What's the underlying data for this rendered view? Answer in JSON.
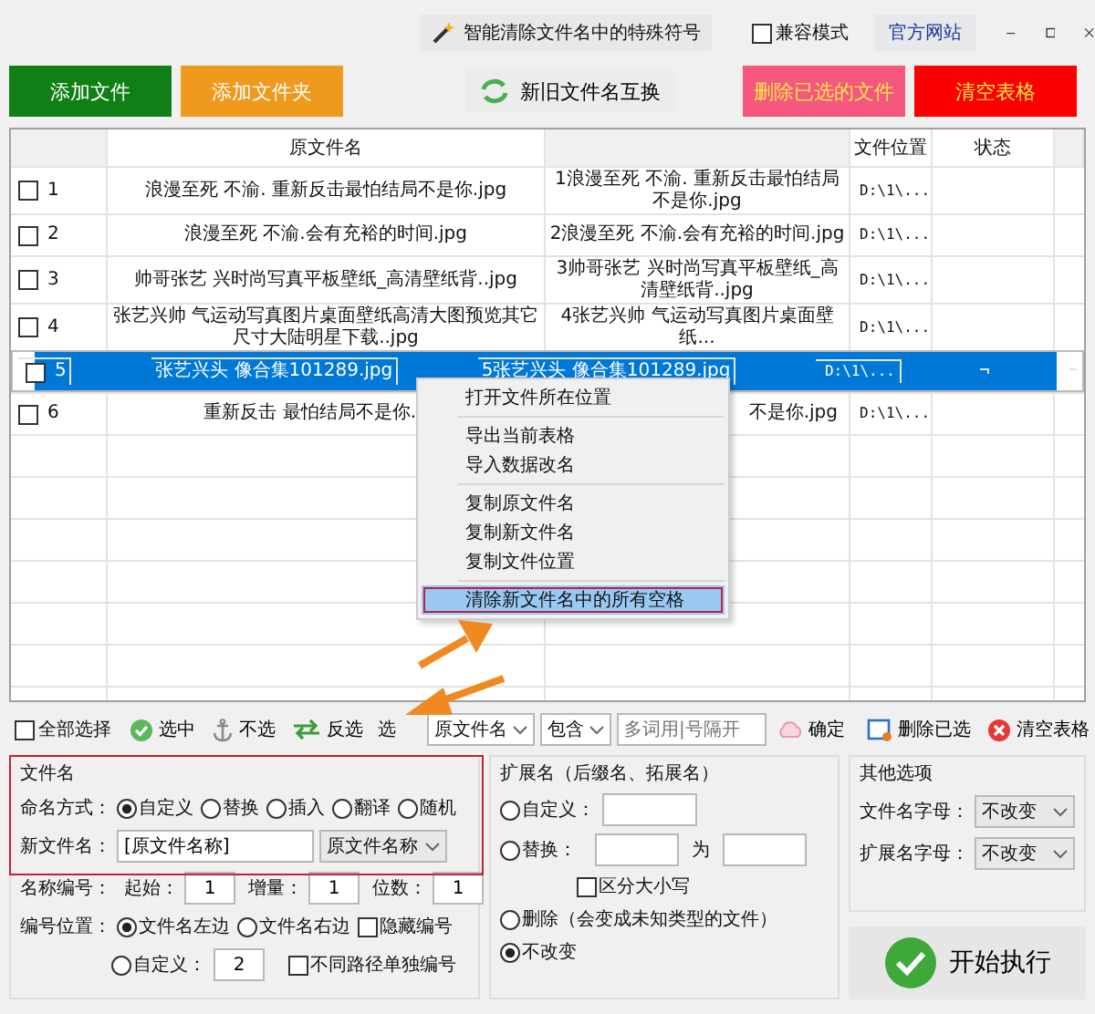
{
  "title_bar": {
    "title": "智能清除文件名中的特殊符号",
    "compat_mode": {
      "label": "兼容模式",
      "checked": false
    },
    "website_link": "官方网站"
  },
  "toolbar": [
    {
      "label": "添加文件",
      "kind": "solid",
      "color": "#108016"
    },
    {
      "label": "添加文件夹",
      "kind": "solid",
      "color": "#ef9a1c"
    },
    {
      "label": "新旧文件名互换",
      "kind": "swap"
    },
    {
      "label": "删除已选的文件",
      "kind": "solid",
      "color": "#f5577f"
    },
    {
      "label": "清空表格",
      "kind": "solid",
      "color": "#fc0000"
    }
  ],
  "table": {
    "header": {
      "column_2": "原文件名",
      "column_4": "文件位置",
      "column_5": "状态"
    },
    "rows": [
      {
        "checked": false,
        "number": "1",
        "original": "浪漫至死 不渝. 重新反击最怕结局不是你.jpg",
        "new": "1浪漫至死 不渝. 重新反击最怕结局不是你.jpg",
        "location": "D:\\1\\...",
        "selected": false
      },
      {
        "checked": false,
        "number": "2",
        "original": "浪漫至死 不渝.会有充裕的时间.jpg",
        "new": "2浪漫至死 不渝.会有充裕的时间.jpg",
        "location": "D:\\1\\...",
        "selected": false
      },
      {
        "checked": false,
        "number": "3",
        "original": "帅哥张艺 兴时尚写真平板壁纸_高清壁纸背..jpg",
        "new": "3帅哥张艺 兴时尚写真平板壁纸_高清壁纸背..jpg",
        "location": "D:\\1\\...",
        "selected": false
      },
      {
        "checked": false,
        "number": "4",
        "original": "张艺兴帅 气运动写真图片桌面壁纸高清大图预览其它尺寸大陆明星下载..jpg",
        "new": "4张艺兴帅 气运动写真图片桌面壁纸...",
        "location": "D:\\1\\...",
        "selected": false
      },
      {
        "checked": false,
        "number": "5",
        "original": "张艺兴头 像合集101289.jpg",
        "new": "5张艺兴头 像合集101289.jpg",
        "location": "D:\\1\\...",
        "selected": true
      },
      {
        "checked": false,
        "number": "6",
        "original": "重新反击 最怕结局不是你.",
        "new": "不是你.jpg",
        "location": "D:\\1\\...",
        "selected": false
      }
    ]
  },
  "context_menu": {
    "groups": [
      [
        {
          "label": "打开文件所在位置",
          "selected": false
        }
      ],
      [
        {
          "label": "导出当前表格",
          "selected": false
        },
        {
          "label": "导入数据改名",
          "selected": false
        }
      ],
      [
        {
          "label": "复制原文件名",
          "selected": false
        },
        {
          "label": "复制新文件名",
          "selected": false
        },
        {
          "label": "复制文件位置",
          "selected": false
        }
      ],
      [
        {
          "label": "清除新文件名中的所有空格",
          "selected": true
        }
      ]
    ]
  },
  "filter_bar": {
    "select_all": {
      "label": "全部选择",
      "checked": false
    },
    "actions": [
      {
        "label": "选中",
        "kind": "check"
      },
      {
        "label": "不选",
        "kind": "anchor"
      },
      {
        "label": "反选",
        "kind": "swap"
      }
    ],
    "cut_label": "选",
    "field_select": "原文件名",
    "match_select": "包含",
    "keyword": {
      "placeholder": "多词用|号隔开"
    },
    "confirm": "确定",
    "right_actions": [
      {
        "label": "删除已选",
        "kind": "delete"
      },
      {
        "label": "清空表格",
        "kind": "clear"
      }
    ]
  },
  "filename_panel": {
    "title": "文件名",
    "naming_mode": {
      "label": "命名方式：",
      "options": [
        {
          "label": "自定义",
          "selected": true
        },
        {
          "label": "替换",
          "selected": false
        },
        {
          "label": "插入",
          "selected": false
        },
        {
          "label": "翻译",
          "selected": false
        },
        {
          "label": "随机",
          "selected": false
        }
      ]
    },
    "new_name": {
      "label": "新文件名：",
      "value": "[原文件名称]",
      "select": "原文件名称"
    },
    "numbering": {
      "label": "名称编号：",
      "fields": [
        {
          "label": "起始：",
          "value": "1"
        },
        {
          "label": "增量：",
          "value": "1"
        },
        {
          "label": "位数：",
          "value": "1"
        }
      ]
    },
    "number_position": {
      "label": "编号位置：",
      "options": [
        {
          "label": "文件名左边",
          "selected": true
        },
        {
          "label": "文件名右边",
          "selected": false
        }
      ],
      "hide_number": {
        "label": "隐藏编号",
        "checked": false
      },
      "custom": {
        "label": "自定义：",
        "selected": false,
        "value": "2"
      },
      "separate_paths": {
        "label": "不同路径单独编号",
        "checked": false
      }
    }
  },
  "extension_panel": {
    "title": "扩展名（后缀名、拓展名）",
    "options": [
      {
        "kind": "custom",
        "label": "自定义：",
        "selected": false
      },
      {
        "kind": "replace",
        "label": "替换：",
        "selected": false,
        "between": "为",
        "case_sensitive": {
          "label": "区分大小写",
          "checked": false
        }
      },
      {
        "kind": "plain",
        "label": "删除（会变成未知类型的文件）",
        "selected": false
      },
      {
        "kind": "plain",
        "label": "不改变",
        "selected": true
      }
    ]
  },
  "other_panel": {
    "title": "其他选项",
    "fields": [
      {
        "label": "文件名字母：",
        "value": "不改变"
      },
      {
        "label": "扩展名字母：",
        "value": "不改变"
      }
    ]
  },
  "start_button": {
    "label": "开始执行"
  }
}
